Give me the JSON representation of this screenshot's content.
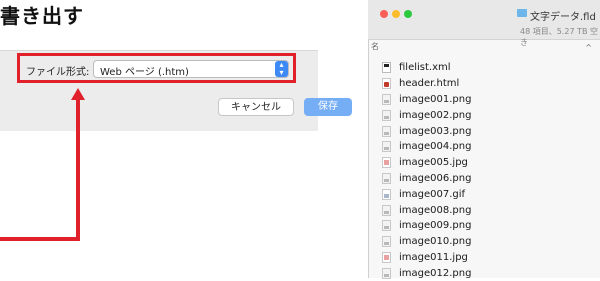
{
  "heading": "書き出す",
  "dialog": {
    "format_label": "ファイル形式:",
    "format_value": "Web ページ (.htm)",
    "cancel_label": "キャンセル",
    "save_label": "保存"
  },
  "finder": {
    "title": "文字データ.fld",
    "status": "48 項目、5.27 TB 空き",
    "column_label": "名",
    "files": [
      {
        "name": "filelist.xml",
        "icon": "xml-file-icon"
      },
      {
        "name": "header.html",
        "icon": "html-file-icon"
      },
      {
        "name": "image001.png",
        "icon": "png-file-icon"
      },
      {
        "name": "image002.png",
        "icon": "png-file-icon"
      },
      {
        "name": "image003.png",
        "icon": "png-file-icon"
      },
      {
        "name": "image004.png",
        "icon": "png-file-icon"
      },
      {
        "name": "image005.jpg",
        "icon": "jpg-file-icon"
      },
      {
        "name": "image006.png",
        "icon": "png-file-icon"
      },
      {
        "name": "image007.gif",
        "icon": "gif-file-icon"
      },
      {
        "name": "image008.png",
        "icon": "png-file-icon"
      },
      {
        "name": "image009.png",
        "icon": "png-file-icon"
      },
      {
        "name": "image010.png",
        "icon": "png-file-icon"
      },
      {
        "name": "image011.jpg",
        "icon": "jpg-file-icon"
      },
      {
        "name": "image012.png",
        "icon": "png-file-icon"
      }
    ]
  },
  "colors": {
    "highlight": "#e0202a",
    "accent": "#3d8af7"
  }
}
